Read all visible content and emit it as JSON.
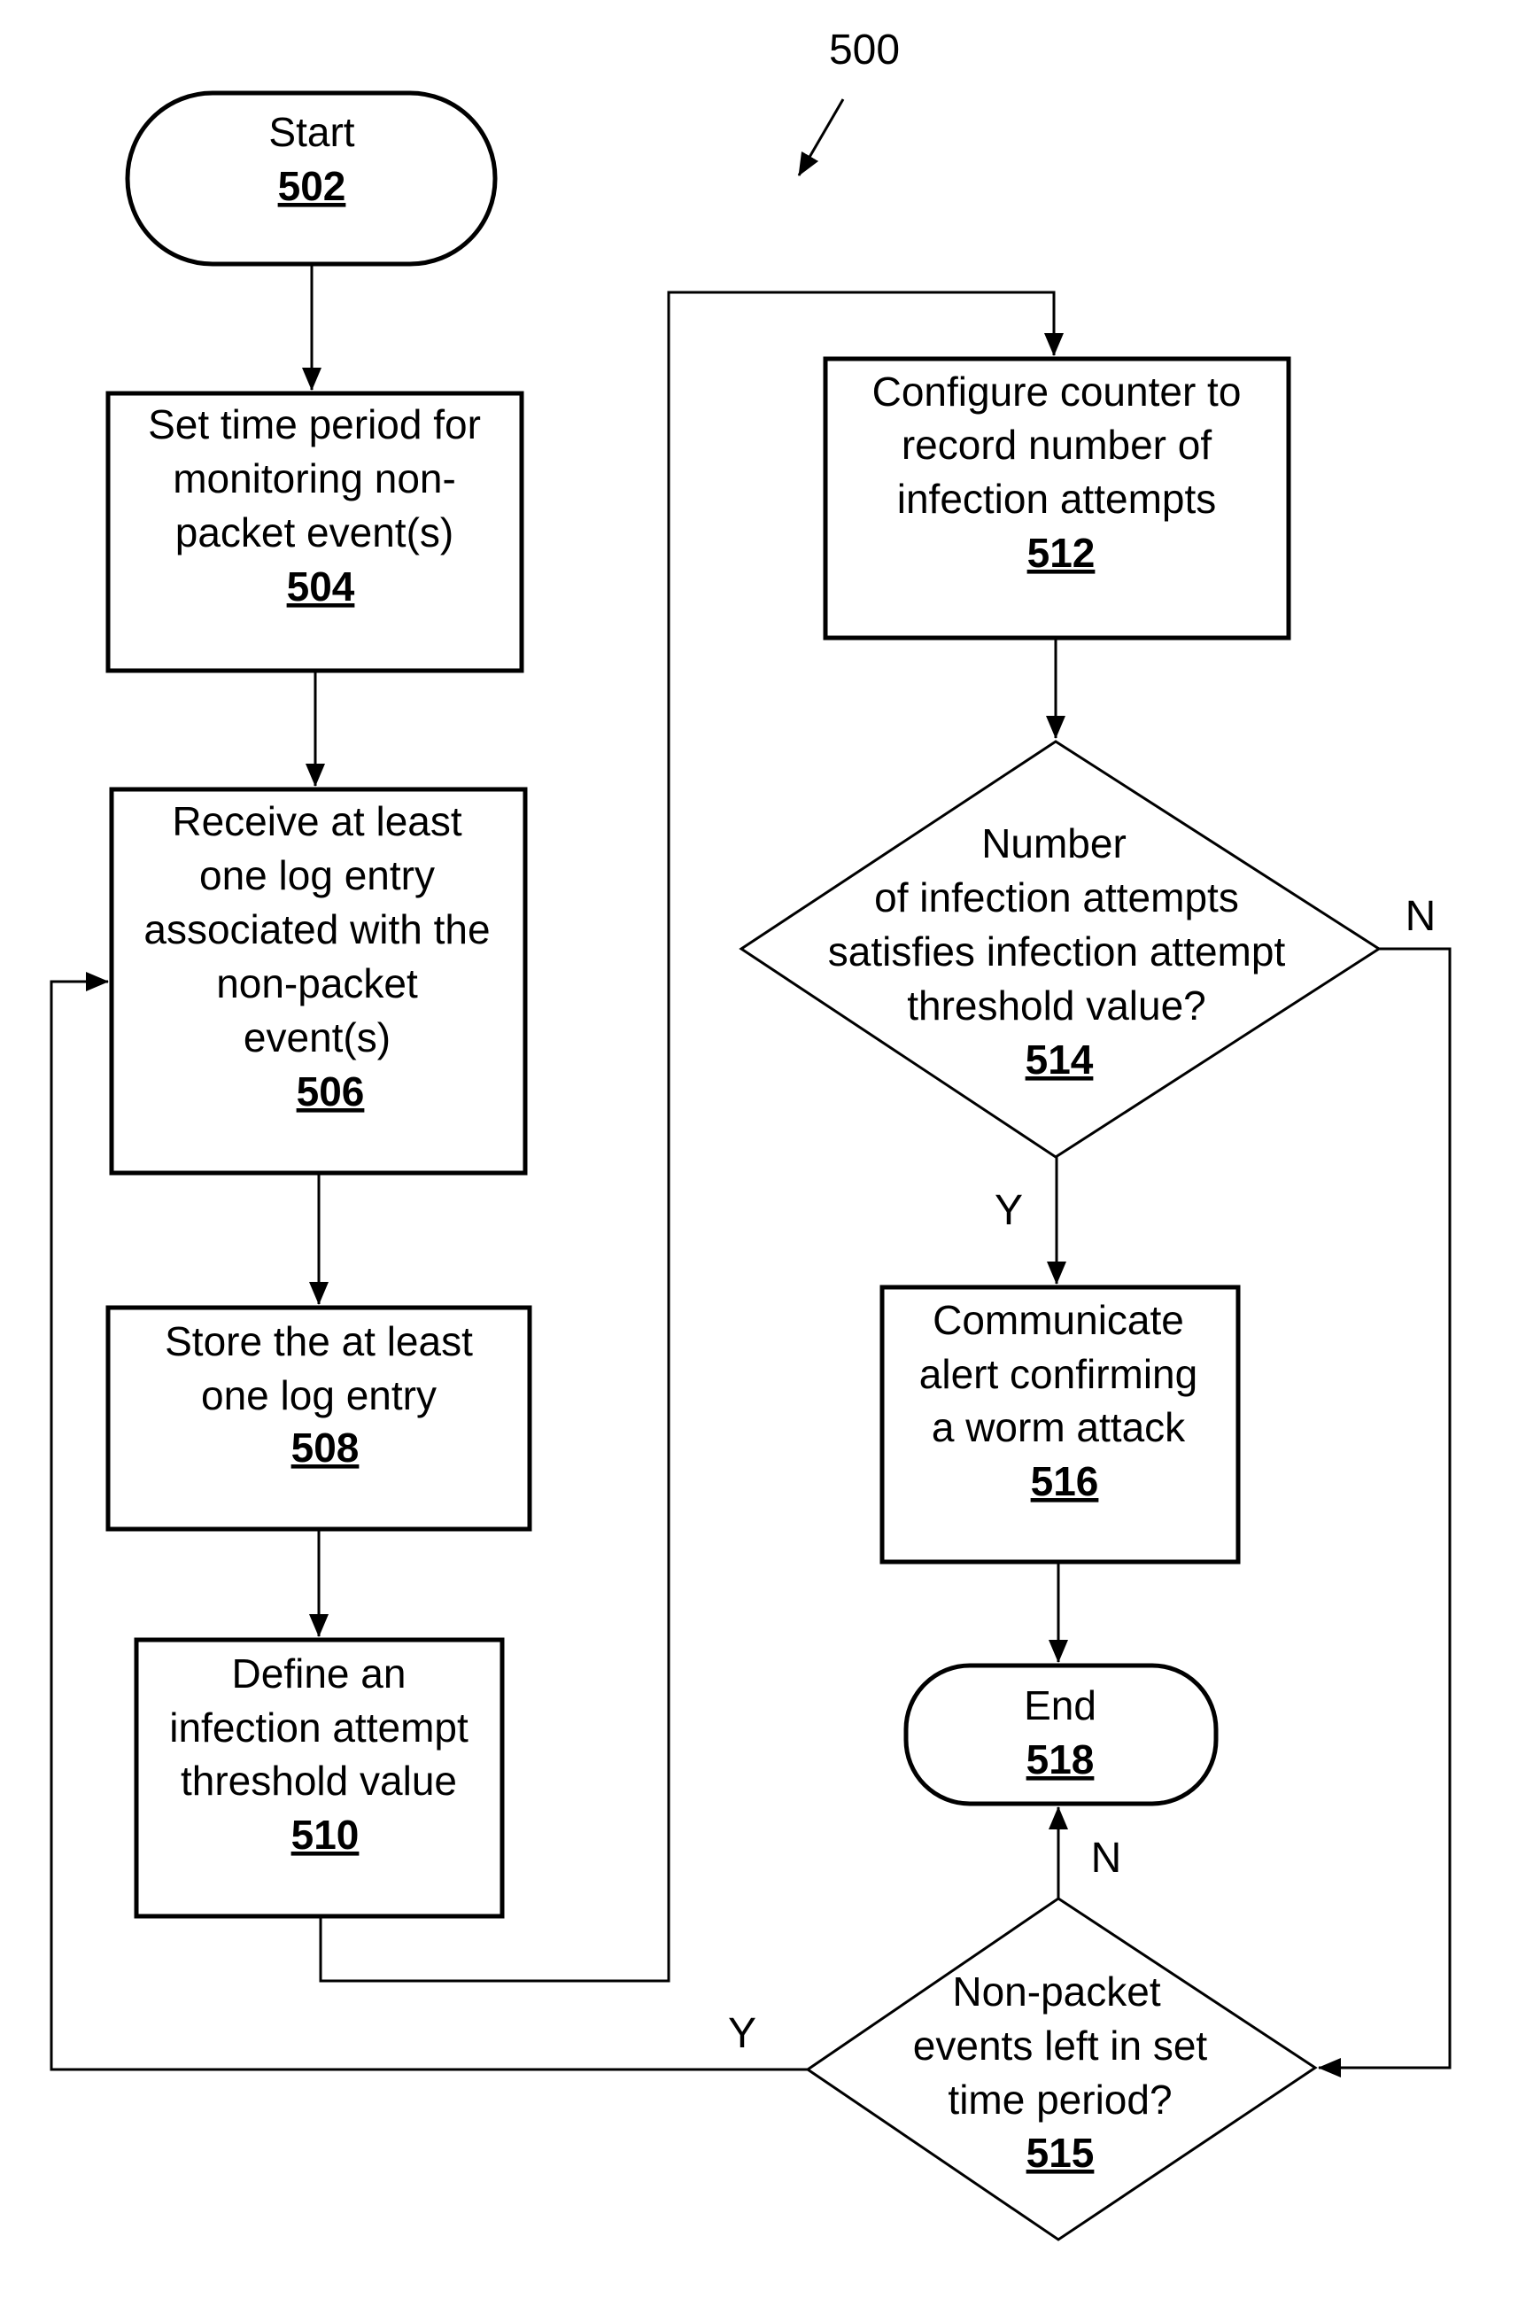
{
  "figure": {
    "reference": "500",
    "nodes": {
      "start": {
        "lines": [
          "Start"
        ],
        "ref": "502"
      },
      "n504": {
        "lines": [
          "Set time period for",
          "monitoring non-",
          "packet event(s)"
        ],
        "ref": "504"
      },
      "n506": {
        "lines": [
          "Receive at least",
          "one log entry",
          "associated with the",
          "non-packet",
          "event(s)"
        ],
        "ref": "506"
      },
      "n508": {
        "lines": [
          "Store the at least",
          "one log entry"
        ],
        "ref": "508"
      },
      "n510": {
        "lines": [
          "Define an",
          "infection attempt",
          "threshold value"
        ],
        "ref": "510"
      },
      "n512": {
        "lines": [
          "Configure counter to",
          "record number of",
          "infection attempts"
        ],
        "ref": "512"
      },
      "n514": {
        "lines": [
          "Number",
          "of infection attempts",
          "satisfies infection attempt",
          "threshold value?"
        ],
        "ref": "514"
      },
      "n516": {
        "lines": [
          "Communicate",
          "alert confirming",
          "a worm attack"
        ],
        "ref": "516"
      },
      "end": {
        "lines": [
          "End"
        ],
        "ref": "518"
      },
      "n515": {
        "lines": [
          "Non-packet",
          "events left in set",
          "time period?"
        ],
        "ref": "515"
      }
    },
    "edge_labels": {
      "n514_yes": "Y",
      "n514_no": "N",
      "n515_yes": "Y",
      "n515_no": "N"
    }
  }
}
